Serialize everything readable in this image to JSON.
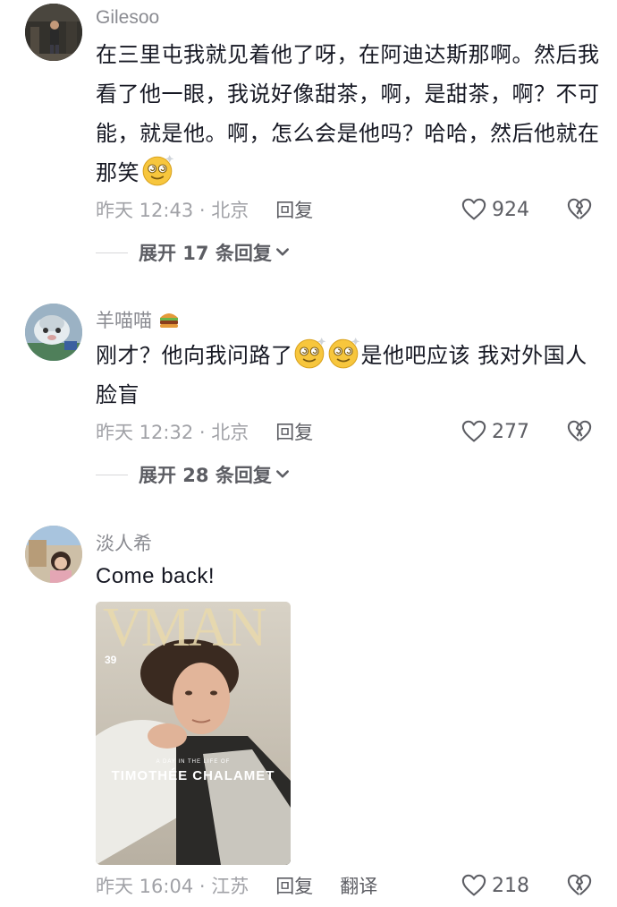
{
  "comments": [
    {
      "username": "Gilesoo",
      "text_parts": [
        "在三里屯我就见着他了呀，在阿迪达斯那啊。然后我看了他一眼，我说好像甜茶，啊，是甜茶，啊？不可能，就是他。啊，怎么会是他吗？哈哈，然后他就在那笑"
      ],
      "time": "昨天 12:43 · 北京",
      "reply_label": "回复",
      "likes": "924",
      "expand_label": "展开 17 条回复"
    },
    {
      "username": "羊喵喵",
      "username_emoji": "hamburger-emoji",
      "text_before": "刚才？他向我问路了",
      "text_after": "是他吧应该 我对外国人脸盲",
      "time": "昨天 12:32 · 北京",
      "reply_label": "回复",
      "likes": "277",
      "expand_label": "展开 28 条回复"
    },
    {
      "username": "淡人希",
      "text": "Come back!",
      "image": {
        "brand": "VMAN",
        "issue": "39",
        "kicker": "A DAY IN THE LIFE OF",
        "name": "TIMOTHÉE CHALAMET"
      },
      "time": "昨天 16:04 · 江苏",
      "reply_label": "回复",
      "translate_label": "翻译",
      "likes": "218"
    }
  ],
  "colors": {
    "text": "#161823",
    "secondary": "#a1a2a7",
    "username": "#8a8b91"
  }
}
